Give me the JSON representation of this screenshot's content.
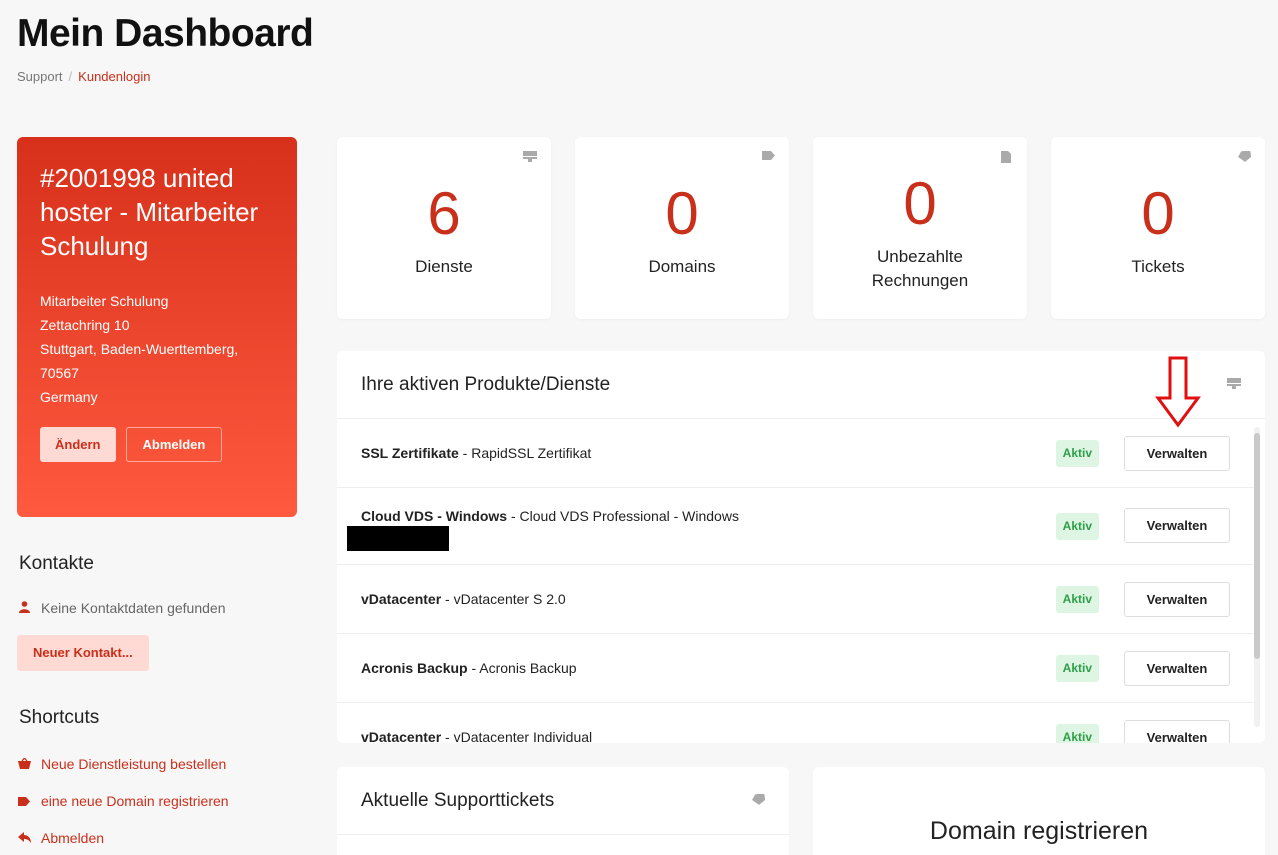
{
  "header": {
    "title": "Mein Dashboard",
    "breadcrumb": {
      "home": "Support",
      "current": "Kundenlogin"
    }
  },
  "client": {
    "title": "#2001998 united hoster - Mitarbeiter Schulung",
    "address": [
      "Mitarbeiter Schulung",
      "Zettachring 10",
      "Stuttgart, Baden-Wuerttemberg,",
      "70567",
      "Germany"
    ],
    "edit_label": "Ändern",
    "logout_label": "Abmelden"
  },
  "contacts": {
    "heading": "Kontakte",
    "empty_text": "Keine Kontaktdaten gefunden",
    "new_label": "Neuer Kontakt..."
  },
  "shortcuts": {
    "heading": "Shortcuts",
    "items": [
      {
        "label": "Neue Dienstleistung bestellen",
        "icon": "basket-icon"
      },
      {
        "label": "eine neue Domain registrieren",
        "icon": "tag-icon"
      },
      {
        "label": "Abmelden",
        "icon": "arrow-back-icon"
      }
    ]
  },
  "stats": [
    {
      "value": "6",
      "label": "Dienste",
      "icon": "server-icon"
    },
    {
      "value": "0",
      "label": "Domains",
      "icon": "tag-icon"
    },
    {
      "value": "0",
      "label": "Unbezahlte Rechnungen",
      "label_lines": [
        "Unbezahlte",
        "Rechnungen"
      ],
      "icon": "document-icon"
    },
    {
      "value": "0",
      "label": "Tickets",
      "icon": "ticket-icon"
    }
  ],
  "products": {
    "title": "Ihre aktiven Produkte/Dienste",
    "items": [
      {
        "name": "SSL Zertifikate",
        "detail": " - RapidSSL Zertifikat",
        "status": "Aktiv",
        "action": "Verwalten"
      },
      {
        "name": "Cloud VDS - Windows",
        "detail": " - Cloud VDS Professional - Windows",
        "status": "Aktiv",
        "action": "Verwalten"
      },
      {
        "name": "vDatacenter",
        "detail": " - vDatacenter S 2.0",
        "status": "Aktiv",
        "action": "Verwalten"
      },
      {
        "name": "Acronis Backup",
        "detail": " - Acronis Backup",
        "status": "Aktiv",
        "action": "Verwalten"
      },
      {
        "name": "vDatacenter",
        "detail": " - vDatacenter Individual",
        "status": "Aktiv",
        "action": "Verwalten"
      }
    ]
  },
  "tickets": {
    "title": "Aktuelle Supporttickets"
  },
  "domain": {
    "title": "Domain registrieren"
  },
  "colors": {
    "accent": "#c8301c",
    "active_badge_bg": "#dff5e3",
    "active_badge_text": "#2e9e49"
  }
}
